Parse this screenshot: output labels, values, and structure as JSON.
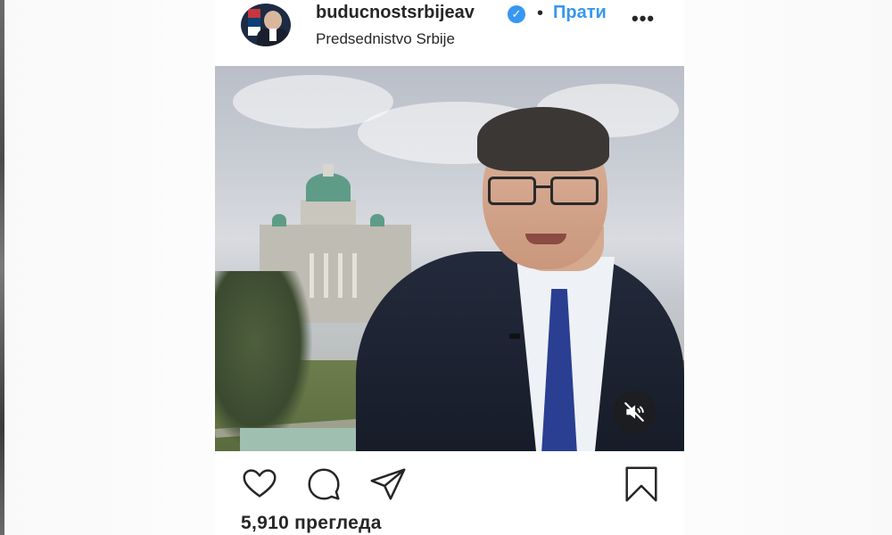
{
  "post": {
    "username": "buducnostsrbijeav",
    "follow_label": "Прати",
    "separator": "•",
    "more_label": "•••",
    "location": "Predsednistvo Srbije",
    "verified": true
  },
  "media": {
    "type": "video",
    "muted": true
  },
  "actions": {
    "icons": [
      "heart-icon",
      "comment-icon",
      "share-icon",
      "bookmark-icon"
    ]
  },
  "stats": {
    "views_text": "5,910 прегледа"
  },
  "colors": {
    "link_blue": "#3897f0",
    "text": "#262626",
    "background": "#ffffff"
  }
}
